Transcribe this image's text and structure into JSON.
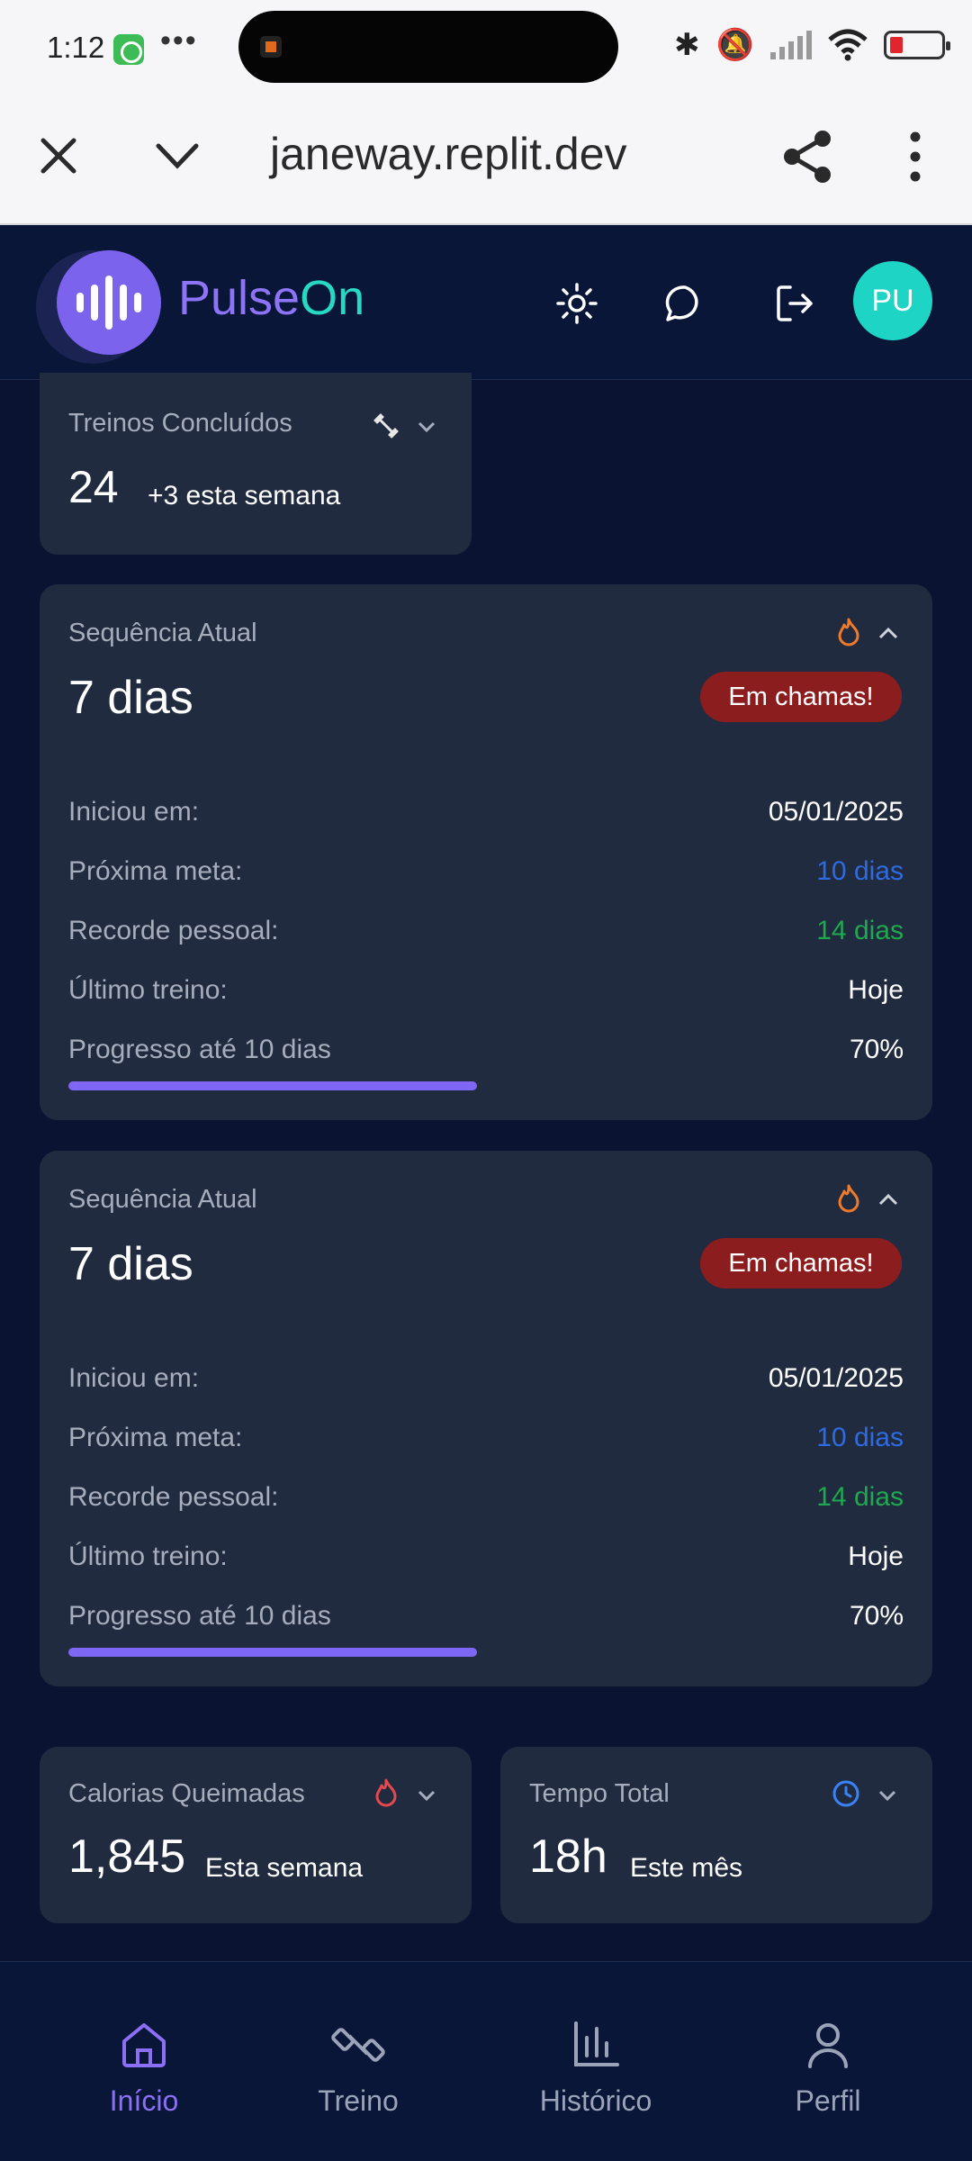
{
  "status_bar": {
    "time": "1:12",
    "dots": "•••"
  },
  "browser": {
    "url": "janeway.replit.dev"
  },
  "app": {
    "brand_part1": "Pulse",
    "brand_part2": "On",
    "avatar_initials": "PU"
  },
  "cards": {
    "treinos": {
      "title": "Treinos Concluídos",
      "value": "24",
      "sub": "+3 esta semana"
    },
    "streaks": [
      {
        "title": "Sequência Atual",
        "value": "7 dias",
        "badge": "Em chamas!",
        "rows": [
          {
            "label": "Iniciou em:",
            "value": "05/01/2025"
          },
          {
            "label": "Próxima meta:",
            "value": "10 dias"
          },
          {
            "label": "Recorde pessoal:",
            "value": "14 dias"
          },
          {
            "label": "Último treino:",
            "value": "Hoje"
          }
        ],
        "progress_label": "Progresso até 10 dias",
        "progress_text": "70%",
        "progress": 0.7
      },
      {
        "title": "Sequência Atual",
        "value": "7 dias",
        "badge": "Em chamas!",
        "rows": [
          {
            "label": "Iniciou em:",
            "value": "05/01/2025"
          },
          {
            "label": "Próxima meta:",
            "value": "10 dias"
          },
          {
            "label": "Recorde pessoal:",
            "value": "14 dias"
          },
          {
            "label": "Último treino:",
            "value": "Hoje"
          }
        ],
        "progress_label": "Progresso até 10 dias",
        "progress_text": "70%",
        "progress": 0.7
      }
    ],
    "calorias": {
      "title": "Calorias Queimadas",
      "value": "1,845",
      "sub": "Esta semana"
    },
    "tempo": {
      "title": "Tempo Total",
      "value": "18h",
      "sub": "Este mês"
    }
  },
  "colors": {
    "meta": "#2f6be0",
    "recorde": "#1fa84f",
    "accent": "#7d67f4",
    "flame": "#f07a2a",
    "clock": "#3b82f6"
  },
  "nav": [
    {
      "label": "Início",
      "icon": "home-icon",
      "active": true
    },
    {
      "label": "Treino",
      "icon": "dumbbell-icon",
      "active": false
    },
    {
      "label": "Histórico",
      "icon": "bar-chart-icon",
      "active": false
    },
    {
      "label": "Perfil",
      "icon": "user-icon",
      "active": false
    }
  ]
}
